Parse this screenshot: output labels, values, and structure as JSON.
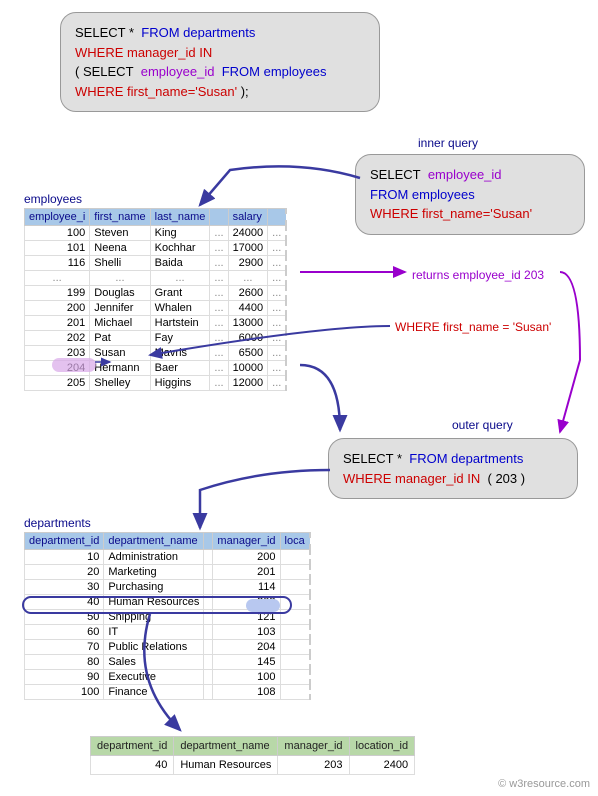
{
  "mainQuery": {
    "l1_select": "SELECT *",
    "l1_from": "FROM departments",
    "l2_where": "WHERE manager_id IN",
    "l3_open": "( SELECT",
    "l3_col": "employee_id",
    "l3_from": "FROM employees",
    "l4_where": "WHERE first_name='Susan'",
    "l4_close": " );"
  },
  "innerQuery": {
    "label": "inner query",
    "l1_select": "SELECT",
    "l1_col": "employee_id",
    "l2_from": "FROM employees",
    "l3_where": "WHERE first_name='Susan'"
  },
  "outerQuery": {
    "label": "outer query",
    "l1_select": "SELECT *",
    "l1_from": "FROM departments",
    "l2_where": "WHERE manager_id IN",
    "l2_val": "( 203 )"
  },
  "annotations": {
    "returns": "returns employee_id 203",
    "whereFirst": "WHERE first_name = 'Susan'"
  },
  "employees": {
    "title": "employees",
    "headers": [
      "employee_i",
      "first_name",
      "last_name",
      "",
      "salary"
    ],
    "rows": [
      [
        "100",
        "Steven",
        "King",
        "...",
        "24000",
        "..."
      ],
      [
        "101",
        "Neena",
        "Kochhar",
        "...",
        "17000",
        "..."
      ],
      [
        "116",
        "Shelli",
        "Baida",
        "...",
        "2900",
        "..."
      ],
      [
        "...",
        "...",
        "...",
        "...",
        "...",
        "..."
      ],
      [
        "199",
        "Douglas",
        "Grant",
        "...",
        "2600",
        "..."
      ],
      [
        "200",
        "Jennifer",
        "Whalen",
        "...",
        "4400",
        "..."
      ],
      [
        "201",
        "Michael",
        "Hartstein",
        "...",
        "13000",
        "..."
      ],
      [
        "202",
        "Pat",
        "Fay",
        "...",
        "6000",
        "..."
      ],
      [
        "203",
        "Susan",
        "Mavris",
        "...",
        "6500",
        "..."
      ],
      [
        "204",
        "Hermann",
        "Baer",
        "...",
        "10000",
        "..."
      ],
      [
        "205",
        "Shelley",
        "Higgins",
        "...",
        "12000",
        "..."
      ]
    ]
  },
  "departments": {
    "title": "departments",
    "headers": [
      "department_id",
      "department_name",
      "",
      "manager_id",
      "loca"
    ],
    "rows": [
      [
        "10",
        "Administration",
        "",
        "200",
        ""
      ],
      [
        "20",
        "Marketing",
        "",
        "201",
        ""
      ],
      [
        "30",
        "Purchasing",
        "",
        "114",
        ""
      ],
      [
        "40",
        "Human Resources",
        "",
        "203",
        ""
      ],
      [
        "50",
        "Shipping",
        "",
        "121",
        ""
      ],
      [
        "60",
        "IT",
        "",
        "103",
        ""
      ],
      [
        "70",
        "Public Relations",
        "",
        "204",
        ""
      ],
      [
        "80",
        "Sales",
        "",
        "145",
        ""
      ],
      [
        "90",
        "Executive",
        "",
        "100",
        ""
      ],
      [
        "100",
        "Finance",
        "",
        "108",
        ""
      ]
    ]
  },
  "result": {
    "headers": [
      "department_id",
      "department_name",
      "manager_id",
      "location_id"
    ],
    "row": [
      "40",
      "Human Resources",
      "203",
      "2400"
    ]
  },
  "watermark": "© w3resource.com"
}
